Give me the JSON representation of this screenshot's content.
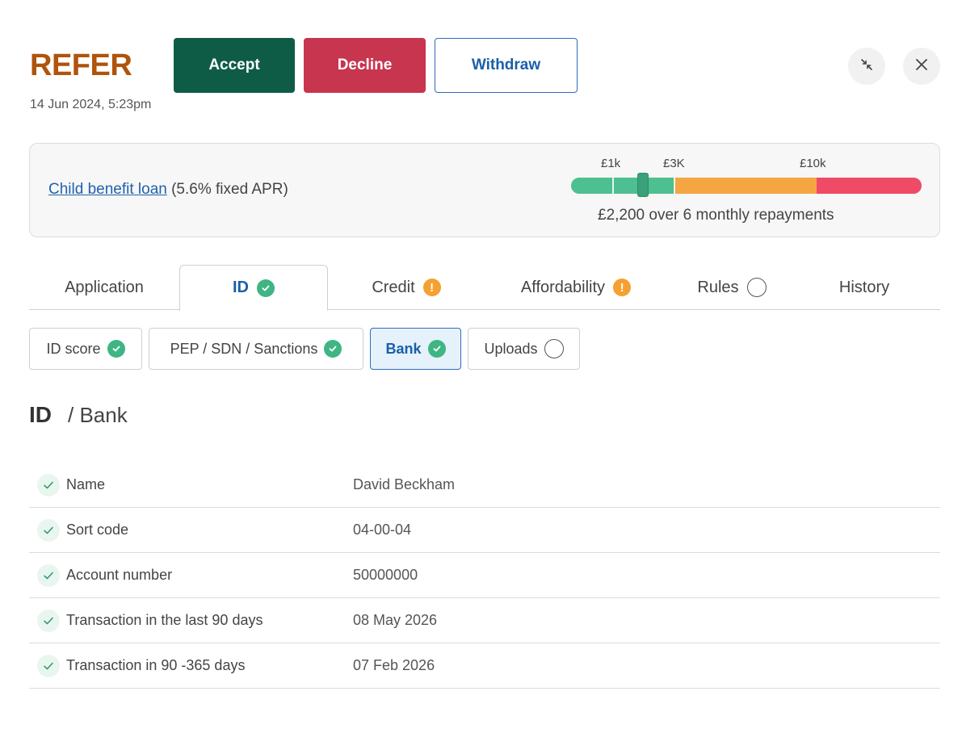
{
  "header": {
    "status": "REFER",
    "timestamp": "14 Jun 2024, 5:23pm",
    "accept_label": "Accept",
    "decline_label": "Decline",
    "withdraw_label": "Withdraw",
    "collapse_icon": "collapse-icon",
    "close_icon": "close-icon"
  },
  "loan": {
    "product_link": "Child benefit loan",
    "apr_text": "(5.6% fixed APR)",
    "scale_labels": [
      "£1k",
      "£3K",
      "£10k"
    ],
    "caption": "£2,200 over 6 monthly repayments"
  },
  "tabs": [
    {
      "label": "Application",
      "status": "none"
    },
    {
      "label": "ID",
      "status": "check"
    },
    {
      "label": "Credit",
      "status": "warning"
    },
    {
      "label": "Affordability",
      "status": "warning"
    },
    {
      "label": "Rules",
      "status": "pending"
    },
    {
      "label": "History",
      "status": "none"
    }
  ],
  "active_tab": "ID",
  "subtabs": [
    {
      "label": "ID score",
      "status": "check"
    },
    {
      "label": "PEP / SDN / Sanctions",
      "status": "check"
    },
    {
      "label": "Bank",
      "status": "check"
    },
    {
      "label": "Uploads",
      "status": "pending"
    }
  ],
  "active_subtab": "Bank",
  "section": {
    "title": "ID",
    "subtitle": "/ Bank"
  },
  "rows": [
    {
      "label": "Name",
      "value": "David Beckham"
    },
    {
      "label": "Sort code",
      "value": "04-00-04"
    },
    {
      "label": "Account number",
      "value": "50000000"
    },
    {
      "label": "Transaction in the last 90 days",
      "value": "08 May 2026"
    },
    {
      "label": "Transaction in 90 -365 days",
      "value": "07 Feb 2026"
    }
  ],
  "colors": {
    "status": "#b0530c",
    "accept": "#0f5c46",
    "decline": "#c8354f",
    "link": "#1f62ad",
    "check": "#3fb584",
    "warning": "#f5a031"
  }
}
